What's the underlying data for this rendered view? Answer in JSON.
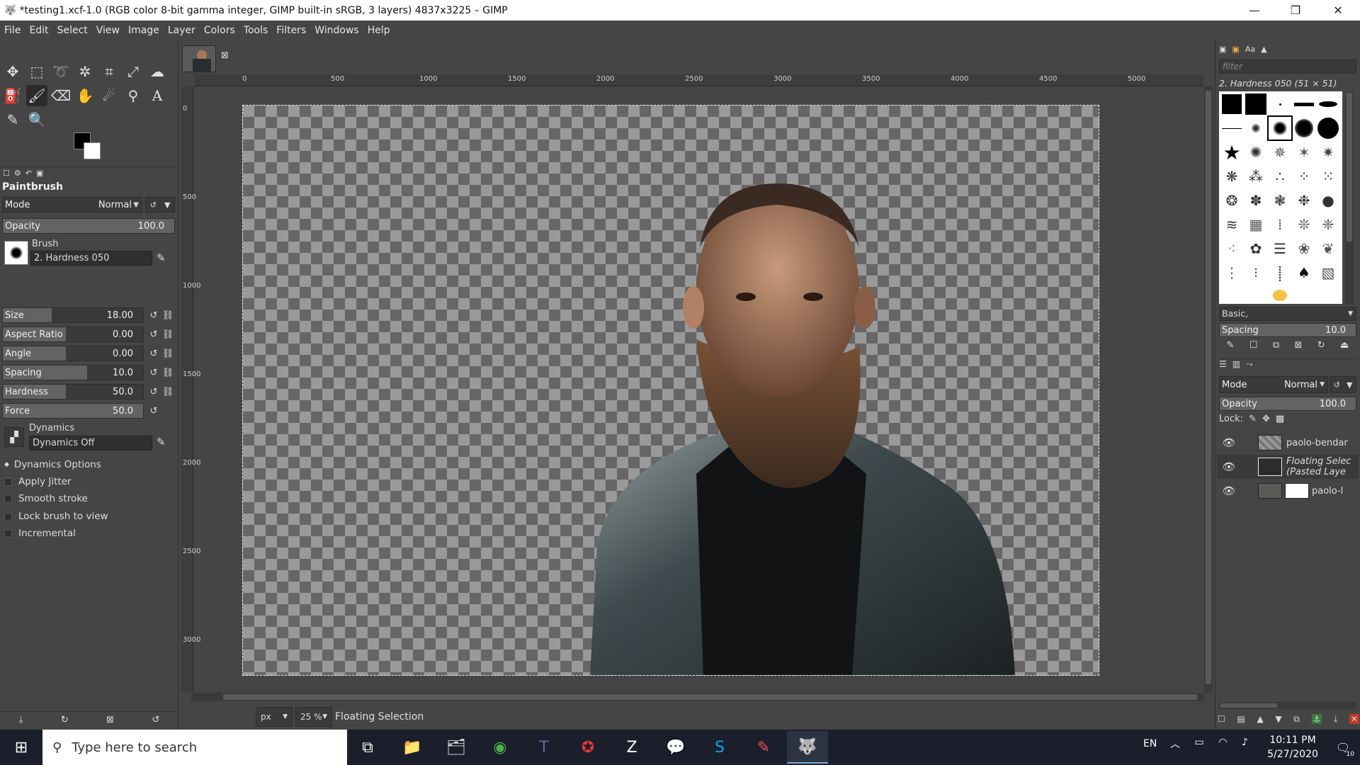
{
  "window": {
    "title": "*testing1.xcf-1.0 (RGB color 8-bit gamma integer, GIMP built-in sRGB, 3 layers) 4837x3225 – GIMP",
    "controls": {
      "minimize": "—",
      "maximize": "❐",
      "close": "✕"
    }
  },
  "menu": [
    "File",
    "Edit",
    "Select",
    "View",
    "Image",
    "Layer",
    "Colors",
    "Tools",
    "Filters",
    "Windows",
    "Help"
  ],
  "tool_options": {
    "title": "Paintbrush",
    "mode_label": "Mode",
    "mode_value": "Normal",
    "opacity_label": "Opacity",
    "opacity_value": "100.0",
    "brush_label": "Brush",
    "brush_value": "2. Hardness 050",
    "sliders": [
      {
        "label": "Size",
        "value": "18.00",
        "fill": 0.18
      },
      {
        "label": "Aspect Ratio",
        "value": "0.00",
        "fill": 0.5
      },
      {
        "label": "Angle",
        "value": "0.00",
        "fill": 0.5
      },
      {
        "label": "Spacing",
        "value": "10.0",
        "fill": 0.1
      },
      {
        "label": "Hardness",
        "value": "50.0",
        "fill": 0.5
      },
      {
        "label": "Force",
        "value": "50.0",
        "fill": 0.5
      }
    ],
    "dynamics_label": "Dynamics",
    "dynamics_value": "Dynamics Off",
    "options": [
      "Dynamics Options",
      "Apply Jitter",
      "Smooth stroke",
      "Lock brush to view",
      "Incremental"
    ]
  },
  "ruler_top": [
    "0",
    "500",
    "1000",
    "1500",
    "2000",
    "2500",
    "3000",
    "3500",
    "4000",
    "4500",
    "5000"
  ],
  "ruler_left": [
    "0",
    "500",
    "1000",
    "1500",
    "2000",
    "2500",
    "3000"
  ],
  "status": {
    "unit": "px",
    "zoom": "25 %",
    "message": "Floating Selection"
  },
  "brushes": {
    "filter_placeholder": "filter",
    "selected": "2. Hardness 050 (51 × 51)",
    "tag": "Basic,",
    "spacing_label": "Spacing",
    "spacing_value": "10.0"
  },
  "layers": {
    "mode_label": "Mode",
    "mode_value": "Normal",
    "opacity_label": "Opacity",
    "opacity_value": "100.0",
    "lock_label": "Lock:",
    "items": [
      {
        "name": "paolo-bendar"
      },
      {
        "name": "Floating Selec",
        "sub": "(Pasted Laye"
      },
      {
        "name": "paolo-l"
      }
    ]
  },
  "taskbar": {
    "search_placeholder": "Type here to search",
    "lang": "EN",
    "time": "10:11 PM",
    "date": "5/27/2020",
    "notifications": "10"
  },
  "colors": {
    "accent": "#2b2b2b",
    "panel": "#454545",
    "taskbar": "#1a1f2b"
  }
}
